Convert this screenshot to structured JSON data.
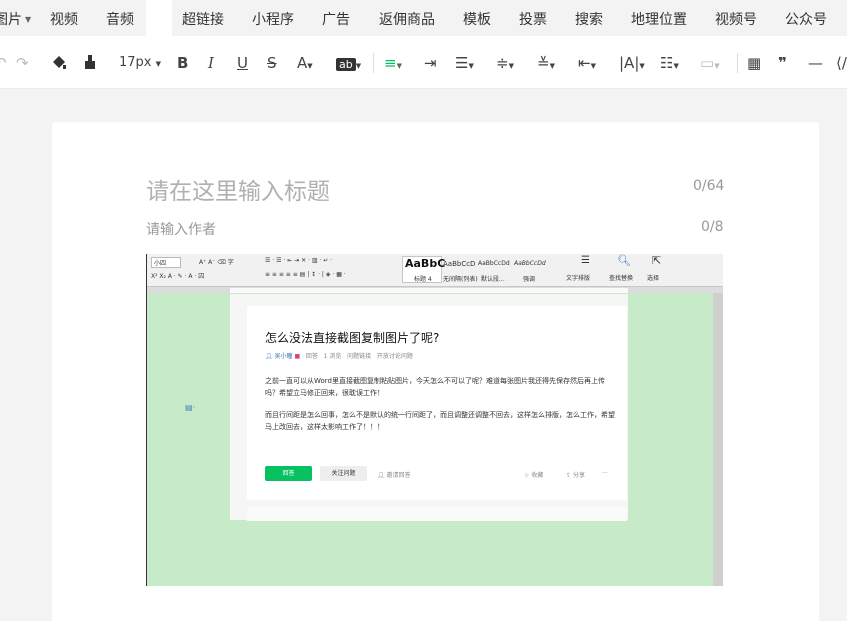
{
  "insert_menu": {
    "items": [
      "图片",
      "视频",
      "音频",
      "超链接",
      "小程序",
      "广告",
      "返佣商品",
      "模板",
      "投票",
      "搜索",
      "地理位置",
      "视频号",
      "公众号"
    ]
  },
  "toolbar": {
    "font_size": "17px",
    "bold": "B",
    "italic": "I",
    "underline": "U",
    "strike": "S",
    "font_color": "A",
    "bg_color": "ab",
    "quote": "❞",
    "hr": "—",
    "code": "⟨/"
  },
  "editor": {
    "title_placeholder": "请在这里输入标题",
    "title_count": "0/64",
    "author_placeholder": "请输入作者",
    "author_count": "0/8"
  },
  "embedded_image": {
    "ribbon": {
      "font_size": "小四",
      "styles": [
        {
          "preview": "AaBbC",
          "name": "标题 4"
        },
        {
          "preview": "AaBbCcD",
          "name": "无间隔(列表)"
        },
        {
          "preview": "AaBbCcDd",
          "name": "默认段..."
        },
        {
          "preview": "AaBbCcDd",
          "name": "强调"
        }
      ],
      "text_layout": "文字排版",
      "find_replace": "查找替换",
      "select": "选择"
    },
    "post": {
      "title": "怎么没法直接截图复制图片了呢?",
      "author": "吴小瞳",
      "meta": [
        "回答",
        "1 浏览",
        "问题链接",
        "开放讨论问题"
      ],
      "body_1": "之前一直可以从Word里直接截图复制粘贴图片，今天怎么不可以了呢？难道每张图片我还得先保存然后再上传吗？希望立马修正回来，很耽误工作！",
      "body_2": "而且行间距是怎么回事，怎么不是默认的统一行间距了，而且调整还调整不回去，这样怎么排版，怎么工作，希望马上改回去，这样太影响工作了！！！",
      "answer_btn": "回答",
      "follow_btn": "关注问题",
      "invite": "邀请回答",
      "collect": "收藏",
      "share": "分享",
      "more": "···"
    }
  },
  "colors": {
    "accent_green": "#07c160",
    "word_canvas": "#c7ebc9"
  }
}
